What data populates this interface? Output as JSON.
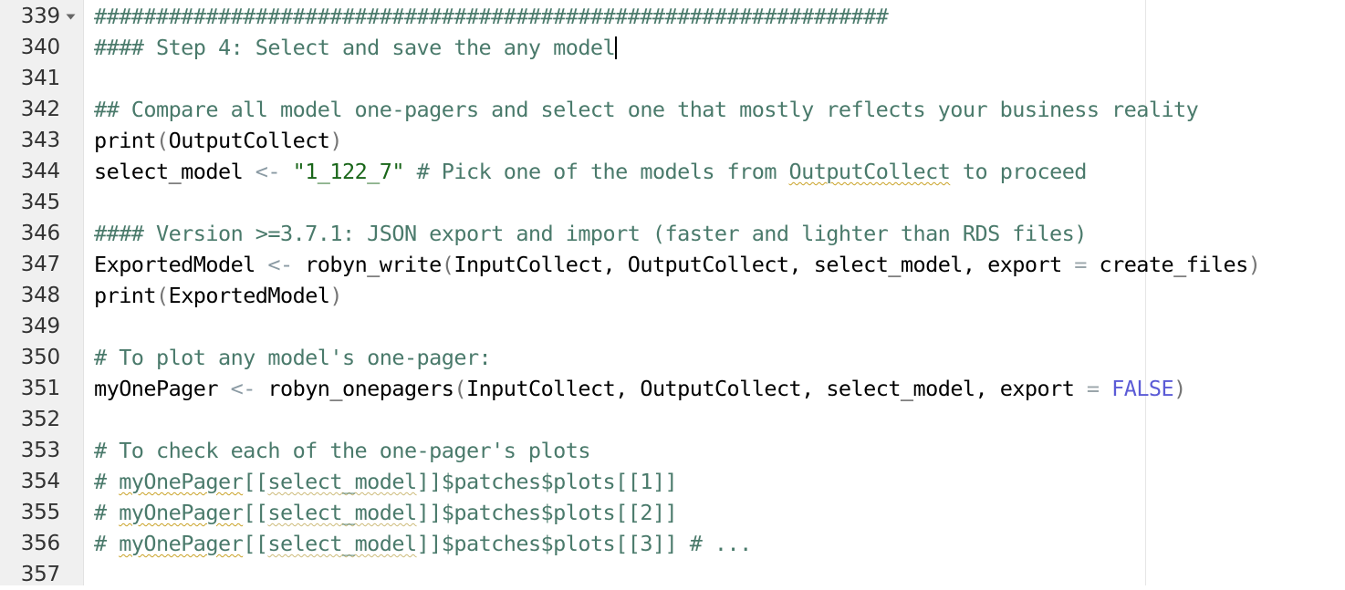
{
  "editor": {
    "name": "r-script-editor",
    "language": "R",
    "colors": {
      "background": "#ffffff",
      "gutter_background": "#f0f0f0",
      "gutter_text": "#333333",
      "comment": "#4a7a6b",
      "string": "#196619",
      "operator": "#8a9aa3",
      "paren": "#757575",
      "keyword": "#5b5bd6",
      "identifier": "#000000",
      "spellcheck_underline": "#c9a227",
      "margin_guide": "#e6e6e6"
    },
    "margin_guide_column": 80,
    "cursor": {
      "line": 340,
      "after_text": "#### Step 4: Select and save the any model"
    },
    "fold_marker_lines": [
      339
    ]
  },
  "lines": [
    {
      "number": "339",
      "fold": true,
      "tokens": [
        {
          "t": "################################################################",
          "c": "cm"
        }
      ]
    },
    {
      "number": "340",
      "fold": false,
      "caret_at_end": true,
      "tokens": [
        {
          "t": "#### Step 4: Select and save the any model",
          "c": "cm"
        }
      ]
    },
    {
      "number": "341",
      "fold": false,
      "tokens": []
    },
    {
      "number": "342",
      "fold": false,
      "tokens": [
        {
          "t": "## Compare all model one-pagers and select one that mostly reflects your business reality",
          "c": "cm"
        }
      ]
    },
    {
      "number": "343",
      "fold": false,
      "tokens": [
        {
          "t": "print",
          "c": "id"
        },
        {
          "t": "(",
          "c": "paren"
        },
        {
          "t": "OutputCollect",
          "c": "id"
        },
        {
          "t": ")",
          "c": "paren"
        }
      ]
    },
    {
      "number": "344",
      "fold": false,
      "tokens": [
        {
          "t": "select_model ",
          "c": "id"
        },
        {
          "t": "<-",
          "c": "op"
        },
        {
          "t": " ",
          "c": "id"
        },
        {
          "t": "\"1_122_7\"",
          "c": "str"
        },
        {
          "t": " # Pick one of the models from ",
          "c": "cm"
        },
        {
          "t": "OutputCollect",
          "c": "cm sp"
        },
        {
          "t": " to proceed",
          "c": "cm"
        }
      ]
    },
    {
      "number": "345",
      "fold": false,
      "tokens": []
    },
    {
      "number": "346",
      "fold": false,
      "tokens": [
        {
          "t": "#### Version >=3.7.1: JSON export and import (faster and lighter than RDS files)",
          "c": "cm"
        }
      ]
    },
    {
      "number": "347",
      "fold": false,
      "tokens": [
        {
          "t": "ExportedModel ",
          "c": "id"
        },
        {
          "t": "<-",
          "c": "op"
        },
        {
          "t": " robyn_write",
          "c": "id"
        },
        {
          "t": "(",
          "c": "paren"
        },
        {
          "t": "InputCollect, OutputCollect, select_model, export ",
          "c": "id"
        },
        {
          "t": "=",
          "c": "eq"
        },
        {
          "t": " create_files",
          "c": "id"
        },
        {
          "t": ")",
          "c": "paren"
        }
      ]
    },
    {
      "number": "348",
      "fold": false,
      "tokens": [
        {
          "t": "print",
          "c": "id"
        },
        {
          "t": "(",
          "c": "paren"
        },
        {
          "t": "ExportedModel",
          "c": "id"
        },
        {
          "t": ")",
          "c": "paren"
        }
      ]
    },
    {
      "number": "349",
      "fold": false,
      "tokens": []
    },
    {
      "number": "350",
      "fold": false,
      "tokens": [
        {
          "t": "# To plot any model's one-pager:",
          "c": "cm"
        }
      ]
    },
    {
      "number": "351",
      "fold": false,
      "tokens": [
        {
          "t": "myOnePager ",
          "c": "id"
        },
        {
          "t": "<-",
          "c": "op"
        },
        {
          "t": " robyn_onepagers",
          "c": "id"
        },
        {
          "t": "(",
          "c": "paren"
        },
        {
          "t": "InputCollect, OutputCollect, select_model, export ",
          "c": "id"
        },
        {
          "t": "=",
          "c": "eq"
        },
        {
          "t": " ",
          "c": "id"
        },
        {
          "t": "FALSE",
          "c": "kw"
        },
        {
          "t": ")",
          "c": "paren"
        }
      ]
    },
    {
      "number": "352",
      "fold": false,
      "tokens": []
    },
    {
      "number": "353",
      "fold": false,
      "tokens": [
        {
          "t": "# To check each of the one-pager's plots",
          "c": "cm"
        }
      ]
    },
    {
      "number": "354",
      "fold": false,
      "tokens": [
        {
          "t": "# ",
          "c": "cm"
        },
        {
          "t": "myOnePager",
          "c": "cm sp"
        },
        {
          "t": "[[",
          "c": "cm"
        },
        {
          "t": "select_model",
          "c": "cm sp2"
        },
        {
          "t": "]]$patches$plots[[1]]",
          "c": "cm"
        }
      ]
    },
    {
      "number": "355",
      "fold": false,
      "tokens": [
        {
          "t": "# ",
          "c": "cm"
        },
        {
          "t": "myOnePager",
          "c": "cm sp"
        },
        {
          "t": "[[",
          "c": "cm"
        },
        {
          "t": "select_model",
          "c": "cm sp2"
        },
        {
          "t": "]]$patches$plots[[2]]",
          "c": "cm"
        }
      ]
    },
    {
      "number": "356",
      "fold": false,
      "tokens": [
        {
          "t": "# ",
          "c": "cm"
        },
        {
          "t": "myOnePager",
          "c": "cm sp"
        },
        {
          "t": "[[",
          "c": "cm"
        },
        {
          "t": "select_model",
          "c": "cm sp2"
        },
        {
          "t": "]]$patches$plots[[3]] # ...",
          "c": "cm"
        }
      ]
    },
    {
      "number": "357",
      "fold": false,
      "tokens": []
    }
  ]
}
